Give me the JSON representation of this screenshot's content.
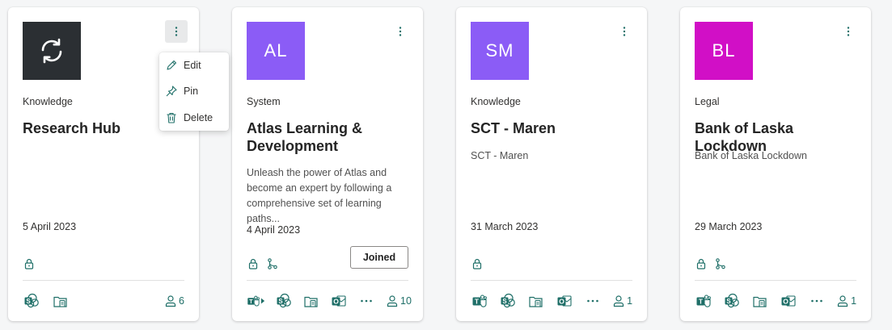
{
  "cards": [
    {
      "category": "Knowledge",
      "title": "Research Hub",
      "date": "5 April 2023",
      "members": "6",
      "avatar": {
        "icon": "sync-icon",
        "bg": "#2b2f33"
      }
    },
    {
      "category": "System",
      "title": "Atlas Learning & Development",
      "description": "Unleash the power of Atlas and become an expert by following a comprehensive set of learning paths...",
      "date": "4 April 2023",
      "members": "10",
      "joined_label": "Joined",
      "avatar": {
        "initials": "AL",
        "bg": "#8b5cf6"
      }
    },
    {
      "category": "Knowledge",
      "title": "SCT - Maren",
      "description": "SCT - Maren",
      "date": "31 March 2023",
      "members": "1",
      "avatar": {
        "initials": "SM",
        "bg": "#8b5cf6"
      }
    },
    {
      "category": "Legal",
      "title": "Bank of Laska Lockdown",
      "description": "Bank of Laska Lockdown",
      "date": "29 March 2023",
      "members": "1",
      "avatar": {
        "initials": "BL",
        "bg": "#d10fc6"
      }
    }
  ],
  "menu": {
    "edit": "Edit",
    "pin": "Pin",
    "delete": "Delete"
  },
  "colors": {
    "accent": "#1f6f68",
    "border": "#e1e1e1"
  }
}
